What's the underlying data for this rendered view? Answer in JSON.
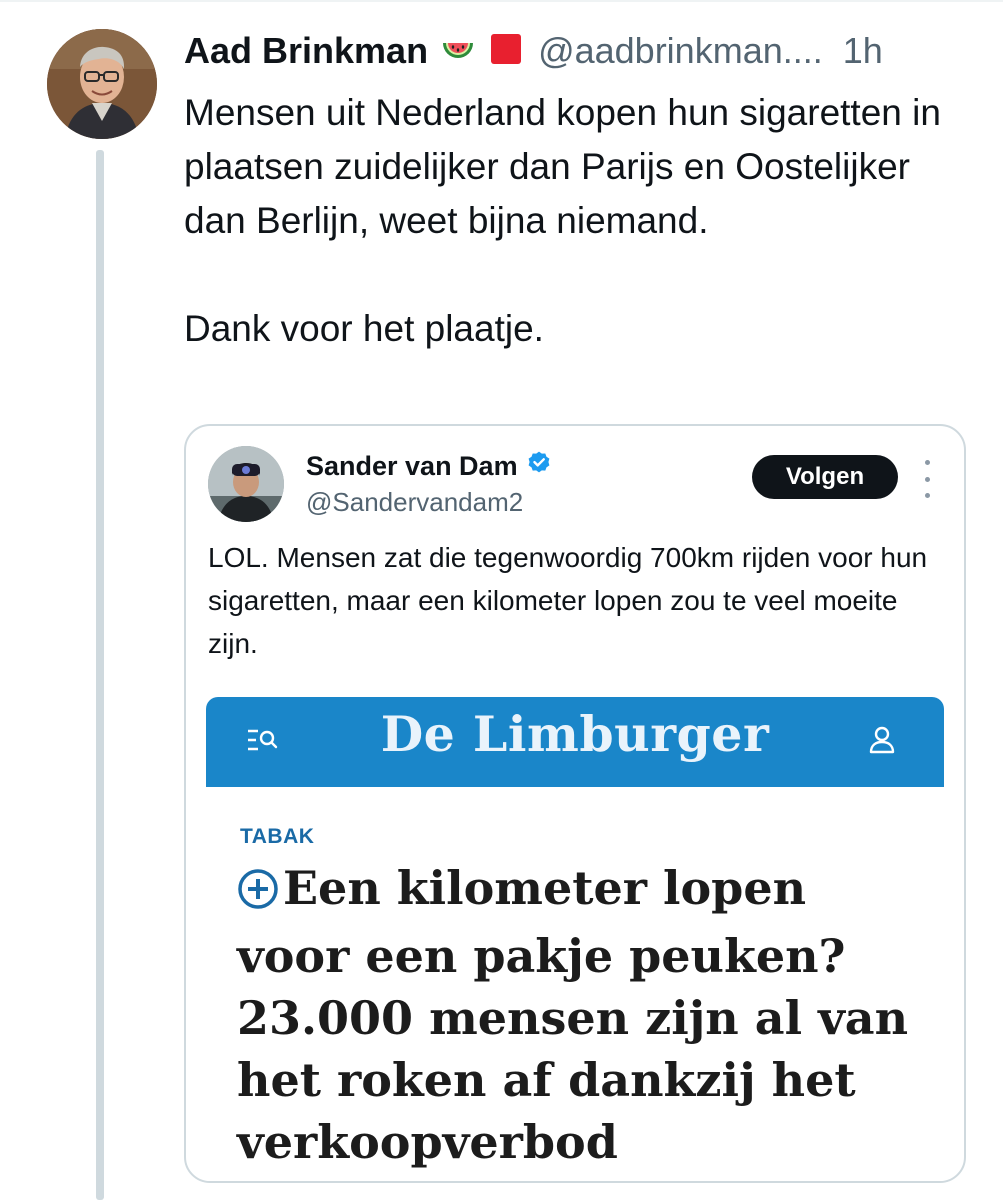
{
  "tweet": {
    "author_name": "Aad Brinkman",
    "author_handle": "@aadbrinkman....",
    "time": "1h",
    "emojis": [
      "watermelon-icon",
      "red-square-icon"
    ],
    "text_paragraphs": [
      "Mensen uit Nederland kopen hun sigaretten in plaatsen zuidelijker dan Parijs en Oostelijker dan Berlijn, weet bijna niemand.",
      "Dank voor het plaatje."
    ]
  },
  "quoted_tweet": {
    "author_name": "Sander van Dam",
    "author_handle": "@Sandervandam2",
    "verified": true,
    "follow_label": "Volgen",
    "text": "LOL. Mensen zat die tegenwoordig 700km rijden voor hun sigaretten, maar een kilometer lopen zou te veel moeite zijn.",
    "article": {
      "brand": "De Limburger",
      "kicker": "TABAK",
      "headline": "Een kilometer lopen voor een pakje peuken? 23.000 mensen zijn al van het roken af dankzij het verkoopverbod"
    }
  },
  "colors": {
    "brand_blue": "#1a86c9",
    "verified_blue": "#1d9bf0",
    "kicker_blue": "#1a6aa6",
    "thread_line": "#cfd9de"
  }
}
